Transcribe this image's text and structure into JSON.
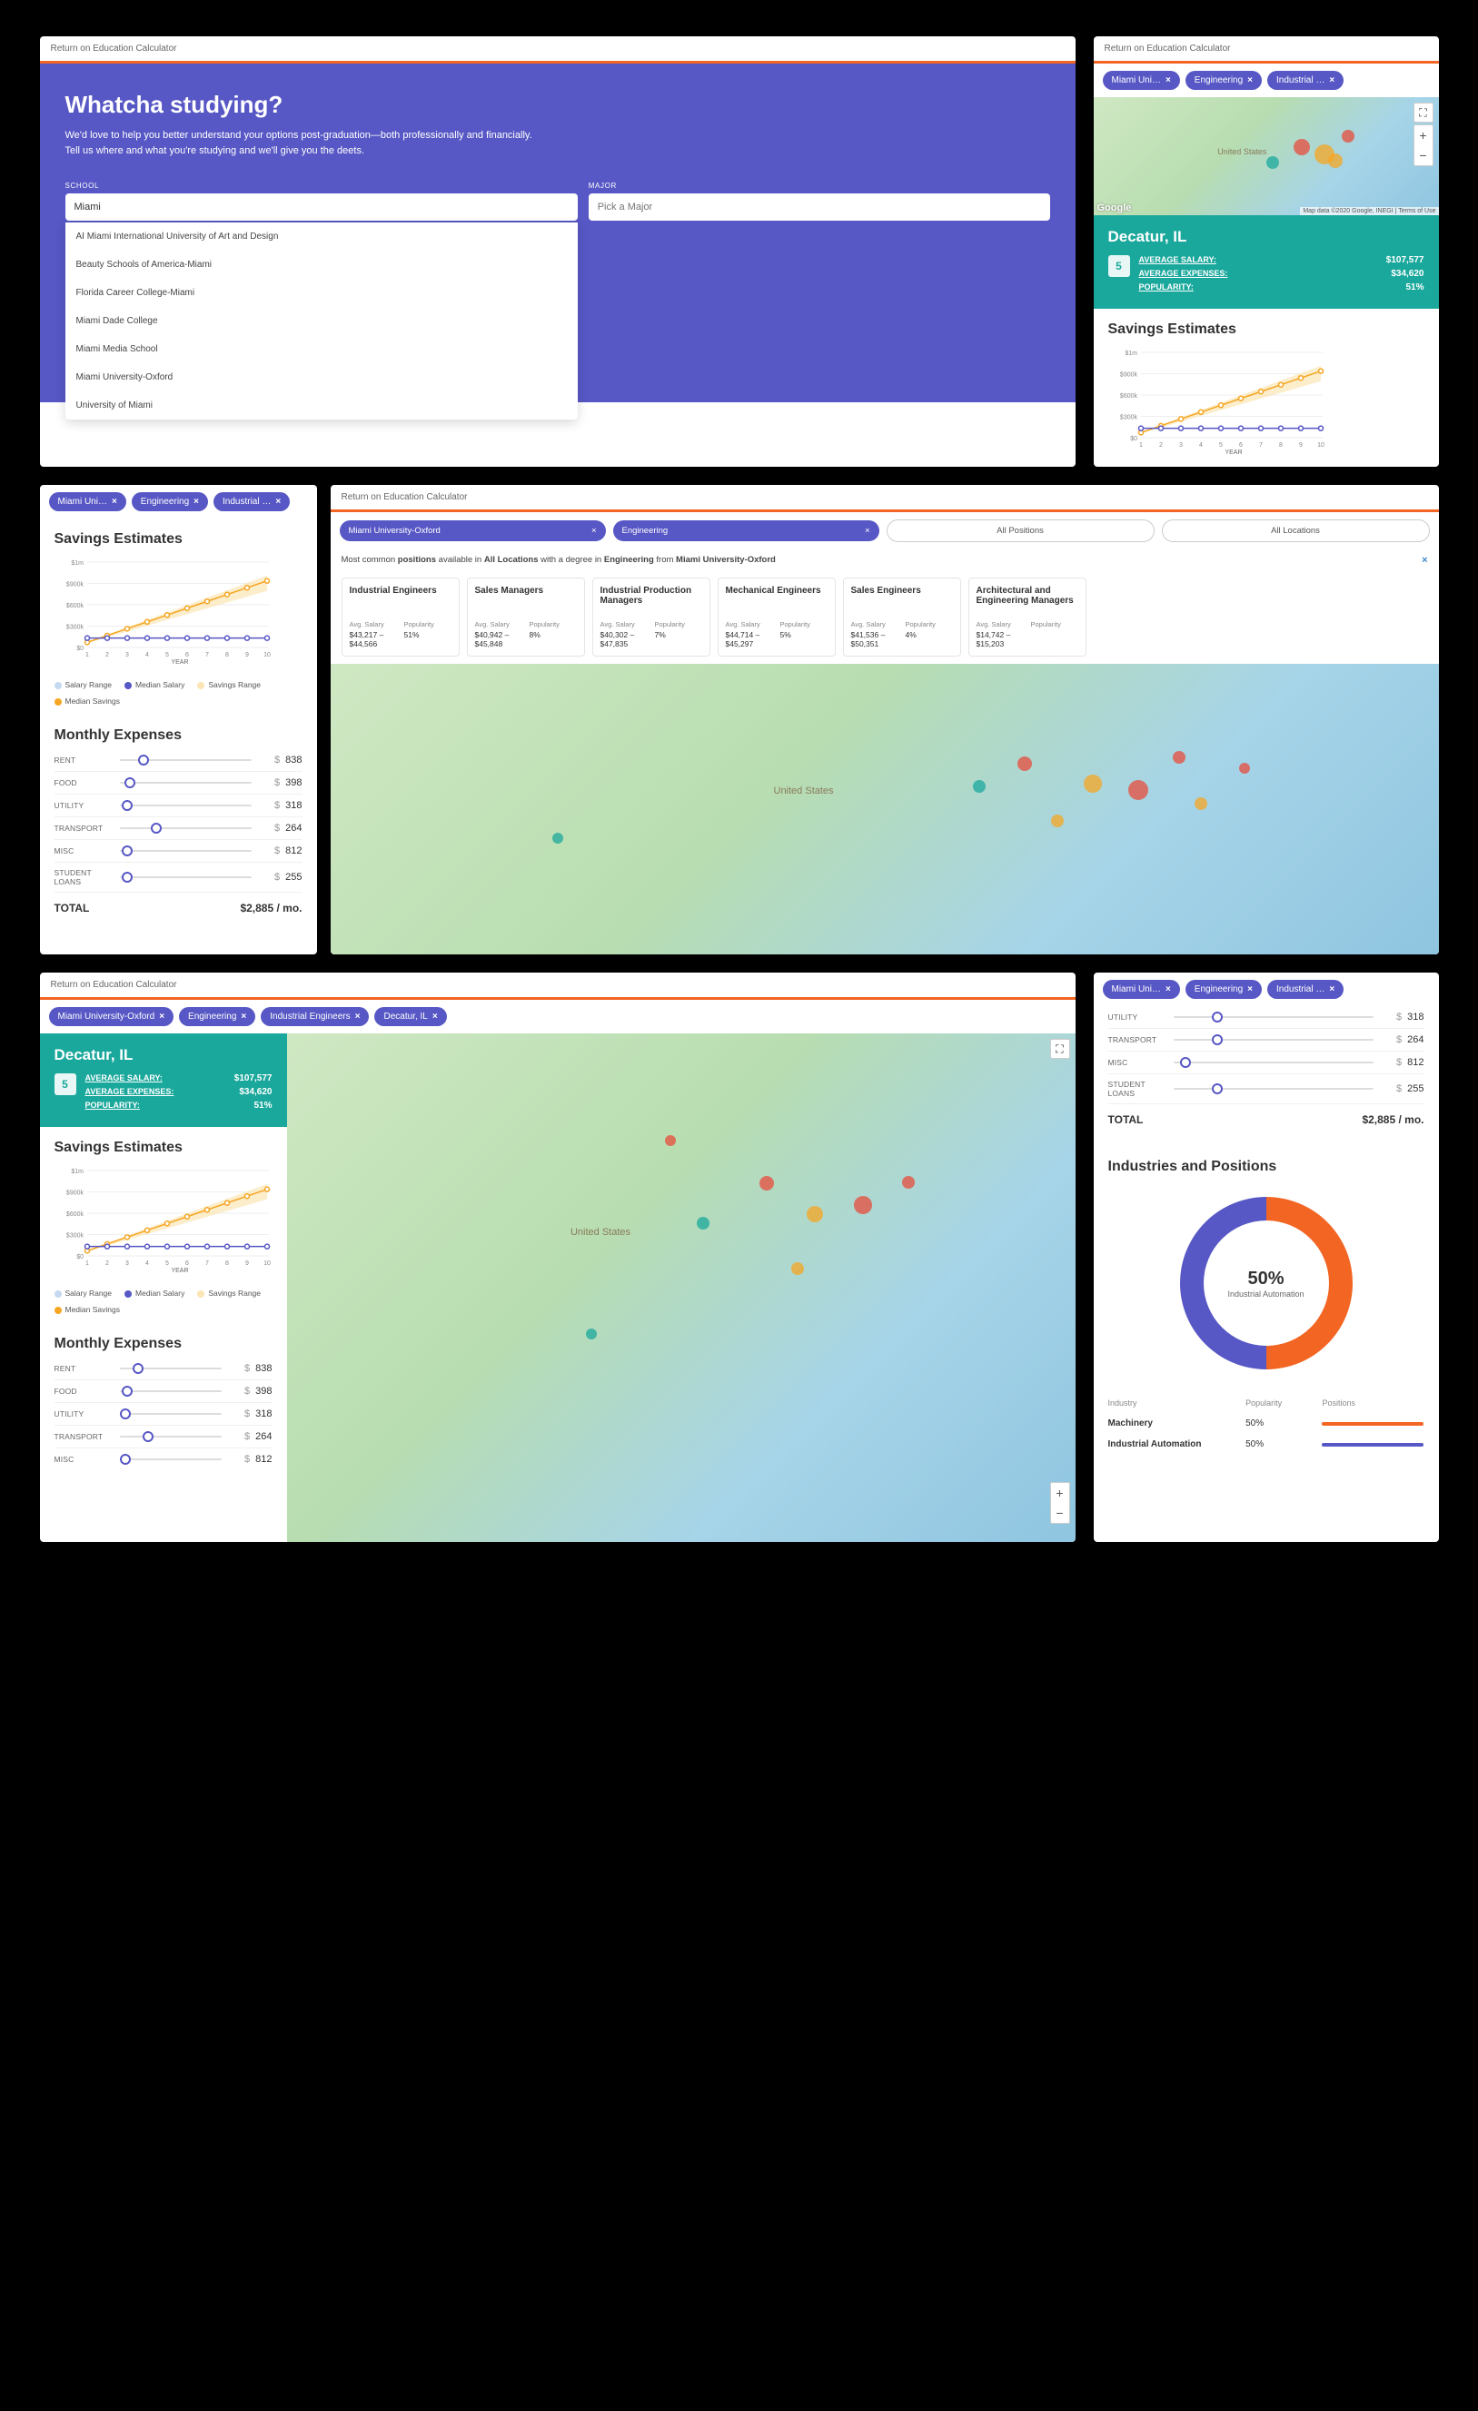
{
  "app_title": "Return on Education Calculator",
  "hero": {
    "heading": "Whatcha studying?",
    "copy": "We'd love to help you better understand your options post-graduation—both professionally and financially. Tell us where and what you're studying and we'll give you the deets.",
    "school_label": "SCHOOL",
    "major_label": "MAJOR",
    "school_value": "Miami",
    "major_placeholder": "Pick a Major",
    "suggestions": [
      "AI Miami International University of Art and Design",
      "Beauty Schools of America-Miami",
      "Florida Career College-Miami",
      "Miami Dade College",
      "Miami Media School",
      "Miami University-Oxford",
      "University of Miami"
    ]
  },
  "chips_short": [
    "Miami Uni…",
    "Engineering",
    "Industrial …"
  ],
  "chips_long": [
    "Miami University-Oxford",
    "Engineering",
    "Industrial Engineers",
    "Decatur, IL"
  ],
  "location": {
    "name": "Decatur, IL",
    "rank": "5",
    "salary_label": "AVERAGE SALARY:",
    "salary_value": "$107,577",
    "expenses_label": "AVERAGE EXPENSES:",
    "expenses_value": "$34,620",
    "pop_label": "POPULARITY:",
    "pop_value": "51%"
  },
  "savings": {
    "title": "Savings Estimates",
    "legend": {
      "sr": "Salary Range",
      "ms": "Median Salary",
      "svr": "Savings Range",
      "msv": "Median Savings"
    },
    "xlabel": "YEAR"
  },
  "chart_data": {
    "type": "line",
    "x": [
      1,
      2,
      3,
      4,
      5,
      6,
      7,
      8,
      9,
      10
    ],
    "series": [
      {
        "name": "Median Savings",
        "values": [
          60000,
          140000,
          220000,
          300000,
          380000,
          460000,
          540000,
          620000,
          700000,
          780000
        ],
        "color": "#f5a623"
      },
      {
        "name": "Median Salary",
        "values": [
          110000,
          110000,
          110000,
          110000,
          110000,
          110000,
          110000,
          110000,
          110000,
          110000
        ],
        "color": "#5757c5"
      }
    ],
    "xlabel": "YEAR",
    "ylim": [
      0,
      1000000
    ],
    "yticks": [
      "$0",
      "$300k",
      "$600k",
      "$900k",
      "$1m"
    ]
  },
  "expenses": {
    "title": "Monthly Expenses",
    "rows": [
      {
        "label": "RENT",
        "value": "838",
        "pos": 18
      },
      {
        "label": "FOOD",
        "value": "398",
        "pos": 8
      },
      {
        "label": "UTILITY",
        "value": "318",
        "pos": 6
      },
      {
        "label": "TRANSPORT",
        "value": "264",
        "pos": 28
      },
      {
        "label": "MISC",
        "value": "812",
        "pos": 6
      },
      {
        "label": "STUDENT LOANS",
        "value": "255",
        "pos": 6
      }
    ],
    "rows_short": [
      {
        "label": "UTILITY",
        "value": "318",
        "pos": 22
      },
      {
        "label": "TRANSPORT",
        "value": "264",
        "pos": 22
      },
      {
        "label": "MISC",
        "value": "812",
        "pos": 6
      },
      {
        "label": "STUDENT LOANS",
        "value": "255",
        "pos": 22
      }
    ],
    "total_label": "TOTAL",
    "total_value": "$2,885 / mo."
  },
  "positions": {
    "select1": "Miami University-Oxford",
    "select2": "Engineering",
    "filter1": "All Positions",
    "filter2": "All Locations",
    "caption_pre": "Most common ",
    "caption_b1": "positions",
    "caption_mid1": " available in ",
    "caption_b2": "All Locations",
    "caption_mid2": " with a degree in ",
    "caption_b3": "Engineering",
    "caption_mid3": " from ",
    "caption_b4": "Miami University-Oxford",
    "cards": [
      {
        "title": "Industrial Engineers",
        "salary": "$43,217 – $44,566",
        "pop": "51%"
      },
      {
        "title": "Sales Managers",
        "salary": "$40,942 – $45,848",
        "pop": "8%"
      },
      {
        "title": "Industrial Production Managers",
        "salary": "$40,302 – $47,835",
        "pop": "7%"
      },
      {
        "title": "Mechanical Engineers",
        "salary": "$44,714 – $45,297",
        "pop": "5%"
      },
      {
        "title": "Sales Engineers",
        "salary": "$41,536 – $50,351",
        "pop": "4%"
      },
      {
        "title": "Architectural and Engineering Managers",
        "salary": "$14,742 – $15,203",
        "pop": ""
      }
    ],
    "avg_salary_lbl": "Avg. Salary",
    "popularity_lbl": "Popularity"
  },
  "industries": {
    "title": "Industries and Positions",
    "donut_pct": "50%",
    "donut_sub": "Industrial Automation",
    "head": {
      "industry": "Industry",
      "pop": "Popularity",
      "pos": "Positions"
    },
    "rows": [
      {
        "name": "Machinery",
        "pop": "50%",
        "color": "#f26522"
      },
      {
        "name": "Industrial Automation",
        "pop": "50%",
        "color": "#5757c5"
      }
    ]
  },
  "map": {
    "attribution": "Map data ©2020 Google, INEGI",
    "terms": "Terms of Use",
    "label": "United States"
  }
}
